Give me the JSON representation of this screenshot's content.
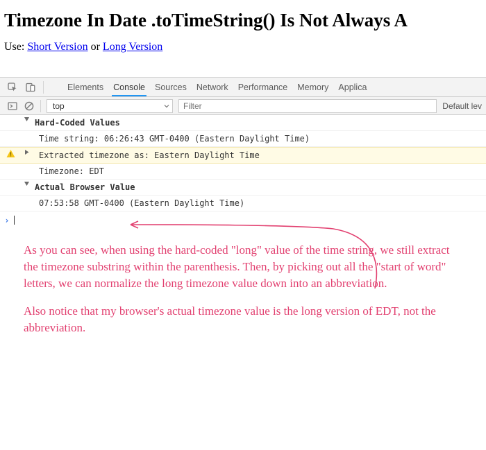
{
  "article": {
    "title": "Timezone In Date .toTimeString() Is Not Always A",
    "use_label": "Use: ",
    "link_short": "Short Version",
    "separator": " or ",
    "link_long": "Long Version"
  },
  "devtools": {
    "tabs": {
      "elements": "Elements",
      "console": "Console",
      "sources": "Sources",
      "network": "Network",
      "performance": "Performance",
      "memory": "Memory",
      "application": "Applica"
    },
    "filter": {
      "context": "top",
      "filter_placeholder": "Filter",
      "levels": "Default lev"
    },
    "messages": {
      "group1_title": "Hard-Coded Values",
      "group1_line1": "Time string: 06:26:43 GMT-0400 (Eastern Daylight Time)",
      "group1_warn": "Extracted timezone as: Eastern Daylight Time",
      "group1_line3": "Timezone: EDT",
      "group2_title": "Actual Browser Value",
      "group2_line1": "07:53:58 GMT-0400 (Eastern Daylight Time)"
    }
  },
  "annotation": {
    "p1": "As you can see, when using the hard-coded \"long\" value of the time string, we still extract the timezone substring within the parenthesis. Then, by picking out all the \"start of word\" letters, we can normalize the long timezone value down into an abbreviation.",
    "p2": "Also notice that my browser's actual timezone value is the long version of EDT, not the abbreviation."
  }
}
